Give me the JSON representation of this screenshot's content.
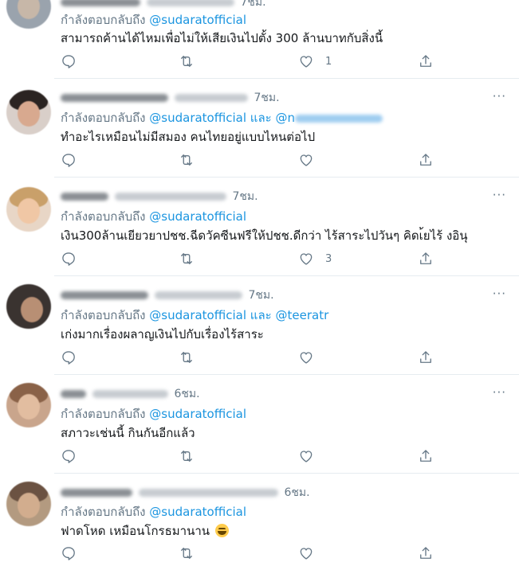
{
  "replying_label": "กำลังตอบกลับถึง",
  "and_label": "และ",
  "icons": [
    "reply-icon",
    "retweet-icon",
    "like-icon",
    "share-icon",
    "more-icon"
  ],
  "tweets": [
    {
      "time": "7ชม.",
      "mention": "@sudaratofficial",
      "second_mention": "",
      "text": "สามารถค้านได้ไหมเพื่อไม่ให้เสียเงินไปตั้ง 300 ล้านบาทกับสิ่งนี้",
      "likes": "1",
      "more": "···"
    },
    {
      "time": "7ชม.",
      "mention": "@sudaratofficial",
      "second_mention": "@n",
      "text": "ทำอะไรเหมือนไม่มีสมอง คนไทยอยู่แบบไหนต่อไป",
      "likes": "",
      "more": "···"
    },
    {
      "time": "7ชม.",
      "mention": "@sudaratofficial",
      "second_mention": "",
      "text": "เงิน300ล้านเยียวยาปชช.ฉีดวัคซีนฟรีให้ปชช.ดีกว่า ไร้สาระไปวันๆ คิดเ้ยไร้ งอินุ",
      "likes": "3",
      "more": "···"
    },
    {
      "time": "7ชม.",
      "mention": "@sudaratofficial",
      "second_mention": "@teeratr",
      "text": "เก่งมากเรื่องผลาญเงินไปกับเรื่องไร้สาระ",
      "likes": "",
      "more": "···"
    },
    {
      "time": "6ชม.",
      "mention": "@sudaratofficial",
      "second_mention": "",
      "text": "สภาวะเช่นนี้ กินกันอีกแล้ว",
      "likes": "",
      "more": "···"
    },
    {
      "time": "6ชม.",
      "mention": "@sudaratofficial",
      "second_mention": "",
      "text": "ฟาดโหด เหมือนโกรธมานาน",
      "likes": "",
      "more": "···"
    }
  ]
}
